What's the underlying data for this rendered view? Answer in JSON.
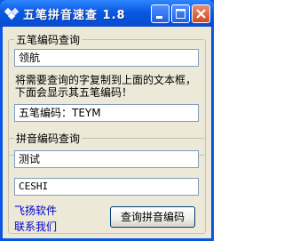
{
  "window": {
    "title": "五笔拼音速查 1.8",
    "controls": {
      "minimize_icon": "minimize-icon",
      "maximize_icon": "maximize-icon",
      "close_icon": "close-icon"
    }
  },
  "wubi": {
    "group_title": "五笔编码查询",
    "input_value": "领航",
    "hint": "将需要查询的字复制到上面的文本框，下面会显示其五笔编码！",
    "result_value": "五笔编码：TEYM"
  },
  "pinyin": {
    "group_title": "拼音编码查询",
    "input_value": "测试",
    "result_value": "CESHI",
    "query_button": "查询拼音编码"
  },
  "links": {
    "software": "飞扬软件",
    "contact": "联系我们"
  },
  "colors": {
    "titlebar": "#0a55e3",
    "client": "#ece9d8",
    "link": "#0000cc"
  }
}
